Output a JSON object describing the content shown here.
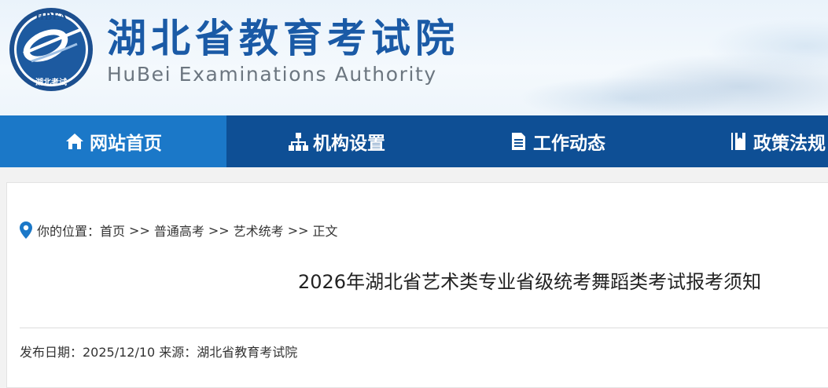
{
  "header": {
    "logo_text": "HBEA",
    "logo_cn": "湖北考试",
    "title": "湖北省教育考试院",
    "subtitle": "HuBei Examinations Authority"
  },
  "nav": {
    "items": [
      {
        "label": "网站首页",
        "icon": "home-icon"
      },
      {
        "label": "机构设置",
        "icon": "org-chart-icon"
      },
      {
        "label": "工作动态",
        "icon": "document-icon"
      },
      {
        "label": "政策法规",
        "icon": "book-icon"
      }
    ]
  },
  "breadcrumb": {
    "prefix": "你的位置：",
    "items": [
      "首页",
      "普通高考",
      "艺术统考",
      "正文"
    ],
    "separator": ">>"
  },
  "article": {
    "title": "2026年湖北省艺术类专业省级统考舞蹈类考试报考须知",
    "meta": "发布日期：2025/12/10 来源：湖北省教育考试院"
  },
  "colors": {
    "nav_bg": "#0e4f95",
    "nav_active": "#1b78c8",
    "title_blue": "#1a5aa6"
  }
}
